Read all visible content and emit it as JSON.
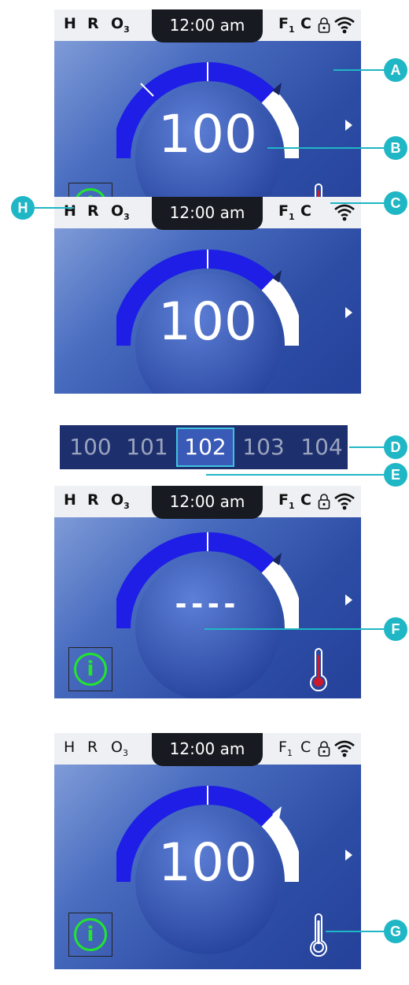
{
  "status": {
    "heater": "H",
    "ready": "R",
    "ozone": "O",
    "ozone_sub": "3",
    "filter": "F",
    "filter_sub": "1",
    "cleanup": "C",
    "clock": "12:00 am"
  },
  "panels": {
    "p1": {
      "temperature": "100"
    },
    "p2": {
      "temperature": "100",
      "picker": [
        "100",
        "101",
        "102",
        "103",
        "104"
      ],
      "selected": "102"
    },
    "p3": {
      "temperature": "----"
    },
    "p4": {
      "temperature": "100"
    }
  },
  "info_label": "i",
  "callouts": {
    "a": "A",
    "b": "B",
    "c": "C",
    "d": "D",
    "e": "E",
    "f": "F",
    "g": "G",
    "h": "H"
  },
  "icons": {
    "lock": "lock-icon",
    "wifi": "wifi-icon",
    "thermometer": "thermometer-icon",
    "info": "info-icon",
    "next": "chevron-right-icon"
  },
  "colors": {
    "accent": "#1fb6c5",
    "info_green": "#22e52e",
    "dial_blue": "#1e1ee6",
    "thermo_red": "#cc1a2a"
  }
}
